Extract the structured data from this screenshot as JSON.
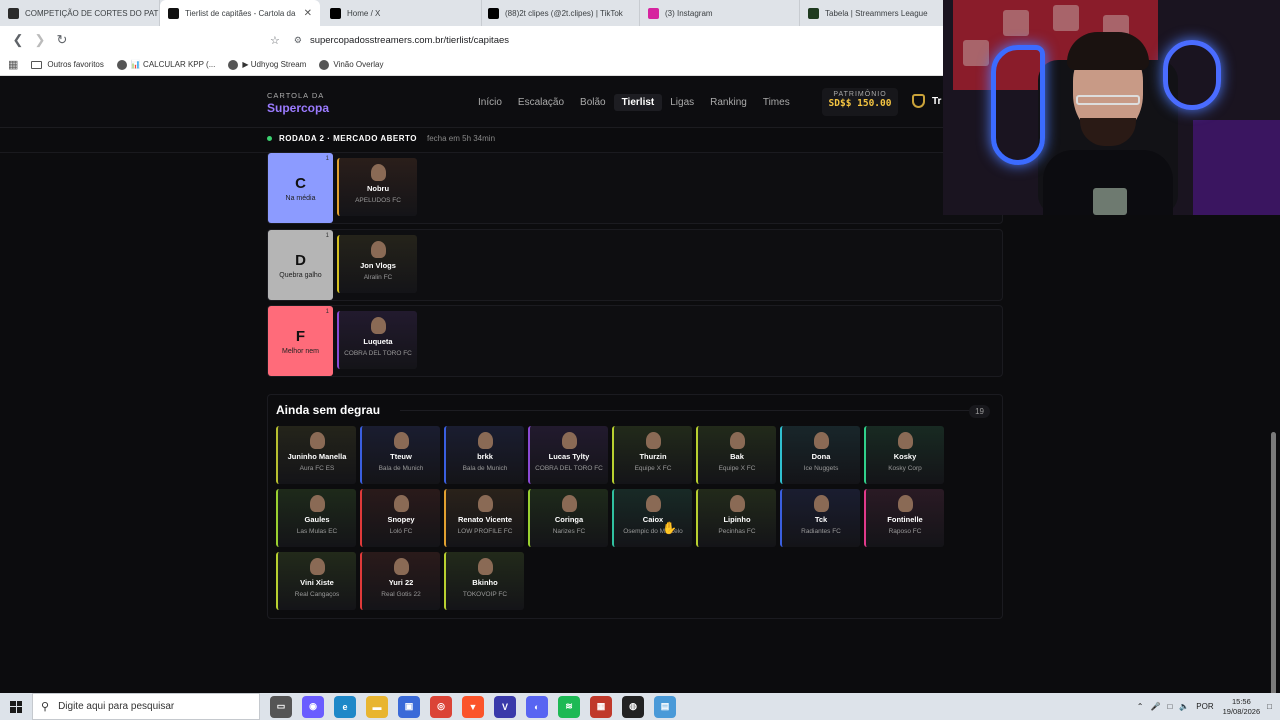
{
  "browser": {
    "tabs": [
      {
        "title": "COMPETIÇÃO DE CORTES DO PATR",
        "icon": "generic-site-icon",
        "color": "#2b2b2b",
        "active": false
      },
      {
        "title": "Tierlist de capitães - Cartola da",
        "icon": "cartola-icon",
        "color": "#111111",
        "active": true
      },
      {
        "title": "Home / X",
        "icon": "x-icon",
        "color": "#000000",
        "active": false
      },
      {
        "title": "(88)2t clipes (@2t.clipes) | TikTok",
        "icon": "tiktok-icon",
        "color": "#000000",
        "active": false
      },
      {
        "title": "(3) Instagram",
        "icon": "instagram-icon",
        "color": "#d6249f",
        "active": false
      },
      {
        "title": "Tabela | Streammers League",
        "icon": "league-icon",
        "color": "#1f3a1f",
        "active": false
      }
    ],
    "url": "supercopadosstreamers.com.br/tierlist/capitaes",
    "bookmarks": [
      {
        "label": "Outros favoritos"
      },
      {
        "label": "📊 CALCULAR KPP (..."
      },
      {
        "label": "▶ Udhyog Stream"
      },
      {
        "label": "Vinão Overlay"
      }
    ]
  },
  "site": {
    "logo_top": "CARTOLA DA",
    "logo_bottom": "Supercopa",
    "nav": [
      "Início",
      "Escalação",
      "Bolão",
      "Tierlist",
      "Ligas",
      "Ranking",
      "Times"
    ],
    "nav_active": "Tierlist",
    "patrimonio_label": "PATRIMÔNIO",
    "patrimonio_value": "SD$$ 150.00",
    "user_trunc": "Tr",
    "rodada_title": "RODADA 2 · MERCADO ABERTO",
    "rodada_status": "fecha em 5h 34min"
  },
  "tiers": [
    {
      "letter": "C",
      "desc": "Na média",
      "count": "1",
      "color": "#8c9bff",
      "players": [
        {
          "name": "Nobru",
          "team": "APELUDOS FC",
          "accent": "#e0a030",
          "bg": "#2a1e1a"
        }
      ]
    },
    {
      "letter": "D",
      "desc": "Quebra galho",
      "count": "1",
      "color": "#b5b5b5",
      "players": [
        {
          "name": "Jon Vlogs",
          "team": "Alralin FC",
          "accent": "#d4c020",
          "bg": "#25231a"
        }
      ]
    },
    {
      "letter": "F",
      "desc": "Melhor nem",
      "count": "1",
      "color": "#ff6b7a",
      "players": [
        {
          "name": "Luqueta",
          "team": "COBRA DEL TORO FC",
          "accent": "#8a4ad4",
          "bg": "#221a2e"
        }
      ]
    }
  ],
  "unranked": {
    "title": "Ainda sem degrau",
    "count": "19",
    "players": [
      {
        "name": "Juninho Manella",
        "team": "Aura FC ES",
        "accent": "#b8c030",
        "bg": "#24241a"
      },
      {
        "name": "Tteuw",
        "team": "Bala de Munich",
        "accent": "#3a5fe0",
        "bg": "#1a1d30"
      },
      {
        "name": "brkk",
        "team": "Bala de Munich",
        "accent": "#3a5fe0",
        "bg": "#1a1d30"
      },
      {
        "name": "Lucas Tylty",
        "team": "COBRA DEL TORO FC",
        "accent": "#8a4ad4",
        "bg": "#221a2e"
      },
      {
        "name": "Thurzin",
        "team": "Equipe X FC",
        "accent": "#b8d030",
        "bg": "#222a1a"
      },
      {
        "name": "Bak",
        "team": "Equipe X FC",
        "accent": "#b8d030",
        "bg": "#222a1a"
      },
      {
        "name": "Dona",
        "team": "Ice Nuggets",
        "accent": "#30c0d0",
        "bg": "#18262a"
      },
      {
        "name": "Kosky",
        "team": "Kosky Corp",
        "accent": "#30d08a",
        "bg": "#182a22"
      },
      {
        "name": "Gaules",
        "team": "Las Mulas EC",
        "accent": "#9ad030",
        "bg": "#1e2a1a"
      },
      {
        "name": "Snopey",
        "team": "Loló FC",
        "accent": "#e03a3a",
        "bg": "#2a1a1a"
      },
      {
        "name": "Renato Vicente",
        "team": "LOW PROFILE FC",
        "accent": "#e0a030",
        "bg": "#2a221a"
      },
      {
        "name": "Coringa",
        "team": "Narizes FC",
        "accent": "#9ad030",
        "bg": "#1e2a1a"
      },
      {
        "name": "Caiox",
        "team": "Osempic do Marcelo",
        "accent": "#30c0a0",
        "bg": "#182a26"
      },
      {
        "name": "Lipinho",
        "team": "Pecinhas FC",
        "accent": "#b8d030",
        "bg": "#222a1a"
      },
      {
        "name": "Tck",
        "team": "Radiantes FC",
        "accent": "#3a5fe0",
        "bg": "#1a1d30"
      },
      {
        "name": "Fontinelle",
        "team": "Raposo FC",
        "accent": "#e03a8a",
        "bg": "#2a1a24"
      },
      {
        "name": "Vini Xiste",
        "team": "Real Cangaços",
        "accent": "#b8d030",
        "bg": "#222a1a"
      },
      {
        "name": "Yuri 22",
        "team": "Real Gotis 22",
        "accent": "#e03a3a",
        "bg": "#2a1a1a"
      },
      {
        "name": "Bkinho",
        "team": "TOKOVOIP FC",
        "accent": "#b8d030",
        "bg": "#222a1a"
      }
    ]
  },
  "taskbar": {
    "search_placeholder": "Digite aqui para pesquisar",
    "apps": [
      {
        "name": "task-view-icon",
        "color": "#555555",
        "glyph": "▭"
      },
      {
        "name": "copilot-icon",
        "color": "#6a5cff",
        "glyph": "◉"
      },
      {
        "name": "edge-icon",
        "color": "#1e88c8",
        "glyph": "e"
      },
      {
        "name": "file-explorer-icon",
        "color": "#e8b530",
        "glyph": "▬"
      },
      {
        "name": "store-icon",
        "color": "#3a6ad8",
        "glyph": "▣"
      },
      {
        "name": "chrome-icon",
        "color": "#db4437",
        "glyph": "◎"
      },
      {
        "name": "brave-icon",
        "color": "#fb542b",
        "glyph": "▼"
      },
      {
        "name": "vegas-icon",
        "color": "#3a3aaa",
        "glyph": "V"
      },
      {
        "name": "discord-icon",
        "color": "#5865f2",
        "glyph": "◐"
      },
      {
        "name": "spotify-icon",
        "color": "#1db954",
        "glyph": "≋"
      },
      {
        "name": "voicemeeter-icon",
        "color": "#c0392b",
        "glyph": "▦"
      },
      {
        "name": "obs-icon",
        "color": "#222222",
        "glyph": "◍"
      },
      {
        "name": "notepad-icon",
        "color": "#4a9ad8",
        "glyph": "▤"
      }
    ],
    "lang": "POR",
    "time": "15:56",
    "date": "19/08/2026"
  }
}
